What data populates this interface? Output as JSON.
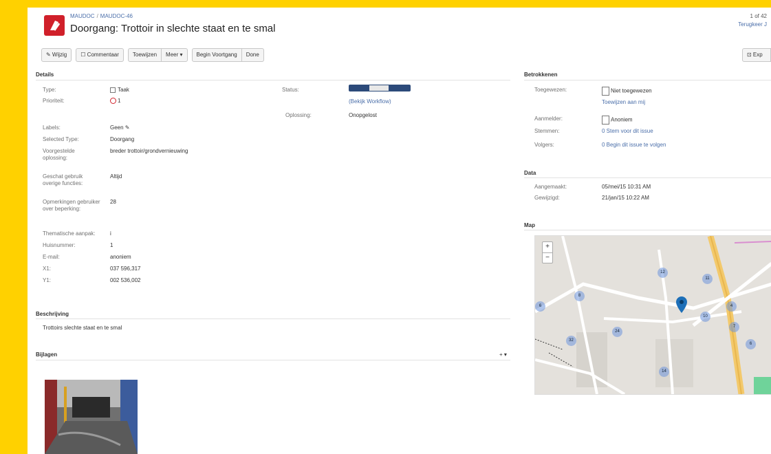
{
  "header": {
    "breadcrumb_project": "MAUDOC",
    "breadcrumb_issue": "MAUDOC-46",
    "title": "Doorgang: Trottoir in slechte staat en te smal",
    "pager": "1 of 42",
    "back_link": "Terugkeer J"
  },
  "toolbar": {
    "buttons": [
      "✎ Wijzig",
      "☐ Commentaar",
      "Toewijzen",
      "Meer ▾",
      "Begin Voortgang",
      "Done"
    ],
    "export_label": "⊡ Exp"
  },
  "details": {
    "heading": "Details",
    "rows": [
      {
        "label": "Type:",
        "value": "Taak"
      },
      {
        "label": "Prioriteit:",
        "value": "1"
      },
      {
        "label": "Labels:",
        "value": "Geen ✎"
      },
      {
        "label": "Selected Type:",
        "value": "Doorgang"
      },
      {
        "label": "Voorgestelde oplossing:",
        "value": "breder trottoir/grondvernieuwing"
      },
      {
        "label": "Geschat gebruik overige functies:",
        "value": "Altijd"
      },
      {
        "label": "Opmerkingen gebruiker over beperking:",
        "value": "28"
      },
      {
        "label": "Thematische aanpak:",
        "value": "i"
      },
      {
        "label": "Huisnummer:",
        "value": "1"
      },
      {
        "label": "E-mail:",
        "value": "anoniem"
      },
      {
        "label": "X1:",
        "value": "037 596,317"
      },
      {
        "label": "Y1:",
        "value": "002 536,002"
      }
    ],
    "status_label": "Status:",
    "workflow_link": "(Bekijk Workflow)",
    "resolution_label": "Oplossing:",
    "resolution_value": "Onopgelost"
  },
  "description": {
    "heading": "Beschrijving",
    "text": "Trottoirs slechte staat en te smal"
  },
  "attachments": {
    "heading": "Bijlagen",
    "actions": "+ ▾"
  },
  "people": {
    "heading": "Betrokkenen",
    "rows": [
      {
        "label": "Toegewezen:",
        "value": "Niet toegewezen"
      },
      {
        "label": "",
        "value": "Toewijzen aan mij"
      },
      {
        "label": "Aanmelder:",
        "value": "Anoniem"
      },
      {
        "label": "Stemmen:",
        "value": "0 Stem voor dit issue"
      },
      {
        "label": "Volgers:",
        "value": "0 Begin dit issue te volgen"
      }
    ]
  },
  "dates": {
    "heading": "Data",
    "rows": [
      {
        "label": "Aangemaakt:",
        "value": "05/mei/15 10:31 AM"
      },
      {
        "label": "Gewijzigd:",
        "value": "21/jan/15 10:22 AM"
      }
    ]
  },
  "map": {
    "heading": "Map",
    "zoom_in": "+",
    "zoom_out": "−",
    "clusters": [
      "12",
      "8",
      "6",
      "10",
      "24",
      "32",
      "14",
      "11",
      "4",
      "7",
      "6"
    ]
  },
  "colors": {
    "background": "#ffd100",
    "brand": "#d0202a",
    "link": "#4a6ea9",
    "status": "#2c4a7a"
  }
}
